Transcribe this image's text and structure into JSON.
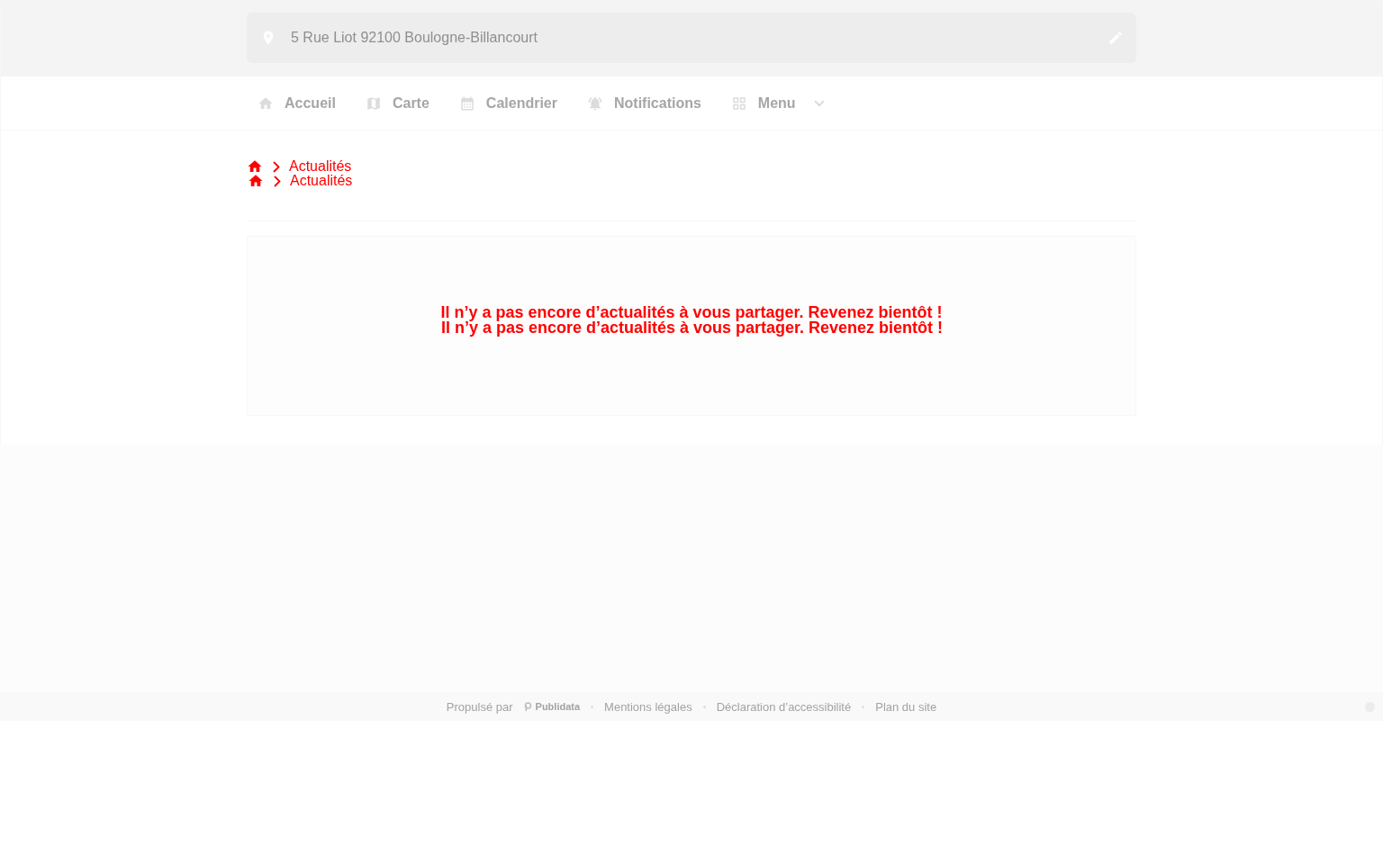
{
  "address_bar": {
    "address": "5 Rue Liot 92100 Boulogne-Billancourt"
  },
  "nav": {
    "items": [
      {
        "label": "Accueil",
        "kind": "link"
      },
      {
        "label": "Carte",
        "kind": "link"
      },
      {
        "label": "Calendrier",
        "kind": "link"
      },
      {
        "label": "Notifications",
        "kind": "link"
      },
      {
        "label": "Menu",
        "kind": "dropdown"
      }
    ]
  },
  "breadcrumbs": [
    {
      "label": "Actualités"
    },
    {
      "label": "Actualités"
    }
  ],
  "news": {
    "messages": [
      "Il n’y a pas encore d’actualités à vous partager. Revenez bientôt !",
      "Il n’y a pas encore d’actualités à vous partager. Revenez bientôt !"
    ]
  },
  "footer": {
    "powered_by": "Propulsé par",
    "brand": "Publidata",
    "links": [
      "Mentions légales",
      "Déclaration d’accessibilité",
      "Plan du site"
    ]
  }
}
